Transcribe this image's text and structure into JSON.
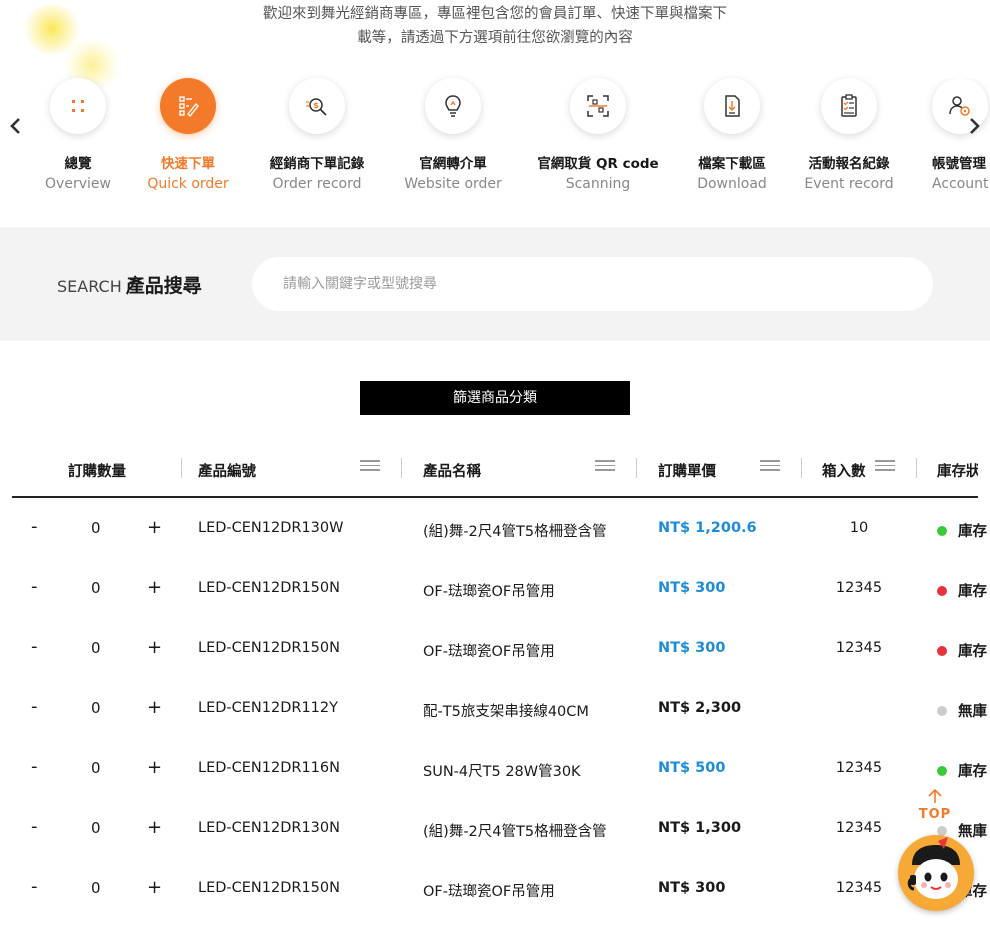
{
  "intro": {
    "line1": "歡迎來到舞光經銷商專區，專區裡包含您的會員訂單、快速下單與檔案下",
    "line2": "載等，請透過下方選項前往您欲瀏覽的內容"
  },
  "nav": {
    "items": [
      {
        "zh": "總覽",
        "en": "Overview",
        "icon": "grid-icon"
      },
      {
        "zh": "快速下單",
        "en": "Quick order",
        "icon": "checklist-pen-icon",
        "active": true
      },
      {
        "zh": "經銷商下單記錄",
        "en": "Order record",
        "icon": "search-money-icon"
      },
      {
        "zh": "官網轉介單",
        "en": "Website order",
        "icon": "lightbulb-icon"
      },
      {
        "zh": "官網取貨 QR code",
        "en": "Scanning",
        "icon": "qr-scan-icon"
      },
      {
        "zh": "檔案下載區",
        "en": "Download",
        "icon": "file-download-icon"
      },
      {
        "zh": "活動報名紀錄",
        "en": "Event record",
        "icon": "clipboard-check-icon"
      },
      {
        "zh": "帳號管理",
        "en": "Account",
        "icon": "user-gear-icon"
      }
    ]
  },
  "search": {
    "label_en": "SEARCH",
    "label_zh": "產品搜尋",
    "placeholder": "請輸入關鍵字或型號搜尋"
  },
  "filter": {
    "label": "篩選商品分類"
  },
  "table": {
    "headers": {
      "qty": "訂購數量",
      "code": "產品編號",
      "name": "產品名稱",
      "price": "訂購單價",
      "box": "箱入數",
      "stock": "庫存狀"
    },
    "rows": [
      {
        "minus": "-",
        "qty": "0",
        "plus": "+",
        "code": "LED-CEN12DR130W",
        "name": "(組)舞-2尺4管T5格柵登含管",
        "price": "NT$ 1,200.6",
        "price_color": "#1f8cd8",
        "box": "10",
        "stock_color": "#3cc83c",
        "stock": "庫存"
      },
      {
        "minus": "-",
        "qty": "0",
        "plus": "+",
        "code": "LED-CEN12DR150N",
        "name": "OF-琺瑯瓷OF吊管用",
        "price": "NT$ 300",
        "price_color": "#1f8cd8",
        "box": "12345",
        "stock_color": "#e8323c",
        "stock": "庫存"
      },
      {
        "minus": "-",
        "qty": "0",
        "plus": "+",
        "code": "LED-CEN12DR150N",
        "name": "OF-琺瑯瓷OF吊管用",
        "price": "NT$ 300",
        "price_color": "#1f8cd8",
        "box": "12345",
        "stock_color": "#e8323c",
        "stock": "庫存"
      },
      {
        "minus": "-",
        "qty": "0",
        "plus": "+",
        "code": "LED-CEN12DR112Y",
        "name": "配-T5旅支架串接線40CM",
        "price": "NT$ 2,300",
        "price_color": "#1a1a1a",
        "box": "",
        "stock_color": "#cccccc",
        "stock": "無庫"
      },
      {
        "minus": "-",
        "qty": "0",
        "plus": "+",
        "code": "LED-CEN12DR116N",
        "name": "SUN-4尺T5 28W管30K",
        "price": "NT$ 500",
        "price_color": "#1f8cd8",
        "box": "12345",
        "stock_color": "#3cc83c",
        "stock": "庫存"
      },
      {
        "minus": "-",
        "qty": "0",
        "plus": "+",
        "code": "LED-CEN12DR130N",
        "name": "(組)舞-2尺4管T5格柵登含管",
        "price": "NT$ 1,300",
        "price_color": "#1a1a1a",
        "box": "12345",
        "stock_color": "#cccccc",
        "stock": "無庫"
      },
      {
        "minus": "-",
        "qty": "0",
        "plus": "+",
        "code": "LED-CEN12DR150N",
        "name": "OF-琺瑯瓷OF吊管用",
        "price": "NT$ 300",
        "price_color": "#1a1a1a",
        "box": "12345",
        "stock_color": "#3cc83c",
        "stock": "庫存"
      }
    ]
  },
  "top_button": {
    "label": "TOP"
  },
  "colors": {
    "accent": "#f47a2a",
    "price_blue": "#1f8cd8",
    "stock_green": "#3cc83c",
    "stock_red": "#e8323c",
    "stock_gray": "#cccccc"
  }
}
